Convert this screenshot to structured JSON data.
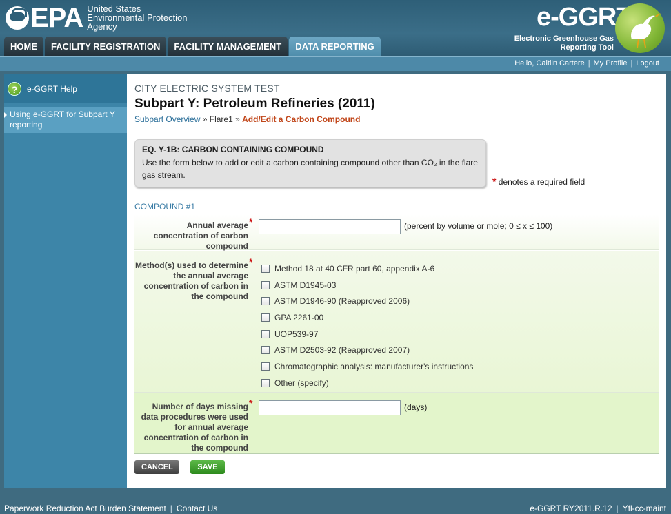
{
  "header": {
    "epa_word": "EPA",
    "agency_lines": [
      "United States",
      "Environmental Protection",
      "Agency"
    ],
    "app_title": "e-GGRT",
    "app_subtitle_lines": [
      "Electronic Greenhouse Gas",
      "Reporting Tool"
    ],
    "brand_color": "#2e5f78"
  },
  "tabs": [
    {
      "label": "HOME"
    },
    {
      "label": "FACILITY REGISTRATION"
    },
    {
      "label": "FACILITY MANAGEMENT"
    },
    {
      "label": "DATA REPORTING",
      "active": true
    }
  ],
  "utilbar": {
    "greeting": "Hello, Caitlin Cartere",
    "my_profile": "My Profile",
    "logout": "Logout",
    "separator": "|"
  },
  "sidebar": {
    "help_label": "e-GGRT Help",
    "help_icon": "question-icon",
    "link_label": "Using e-GGRT for Subpart Y reporting"
  },
  "main": {
    "facility": "CITY ELECTRIC SYSTEM TEST",
    "subpart_title": "Subpart Y: Petroleum Refineries (2011)",
    "breadcrumb": {
      "overview": "Subpart Overview",
      "sep1": "»",
      "flare": "Flare1",
      "sep2": "»",
      "current": "Add/Edit a Carbon Compound"
    },
    "eq_box": {
      "title": "EQ. Y-1B: CARBON CONTAINING COMPOUND",
      "description": "Use the form below to add or edit a carbon containing compound other than CO₂ in the flare gas stream."
    },
    "required_star": "*",
    "required_note": "denotes a required field",
    "section_title": "COMPOUND #1",
    "fields": {
      "concentration": {
        "label": "Annual average concentration of carbon compound",
        "value": "",
        "hint": "(percent by volume or mole; 0 ≤ x ≤ 100)"
      },
      "methods": {
        "label": "Method(s) used to determine the annual average concentration of carbon in the compound",
        "options": [
          "Method 18 at 40 CFR part 60, appendix A-6",
          "ASTM D1945-03",
          "ASTM D1946-90 (Reapproved 2006)",
          "GPA 2261-00",
          "UOP539-97",
          "ASTM D2503-92 (Reapproved 2007)",
          "Chromatographic analysis: manufacturer's instructions",
          "Other (specify)"
        ]
      },
      "days_missing": {
        "label": "Number of days missing data procedures were used for annual average concentration of carbon in the compound",
        "value": "",
        "hint": "(days)"
      }
    },
    "buttons": {
      "cancel": "CANCEL",
      "save": "SAVE"
    }
  },
  "footer": {
    "paperwork": "Paperwork Reduction Act Burden Statement",
    "contact": "Contact Us",
    "version": "e-GGRT RY2011.R.12",
    "server": "Yfl-cc-maint",
    "separator": "|"
  }
}
